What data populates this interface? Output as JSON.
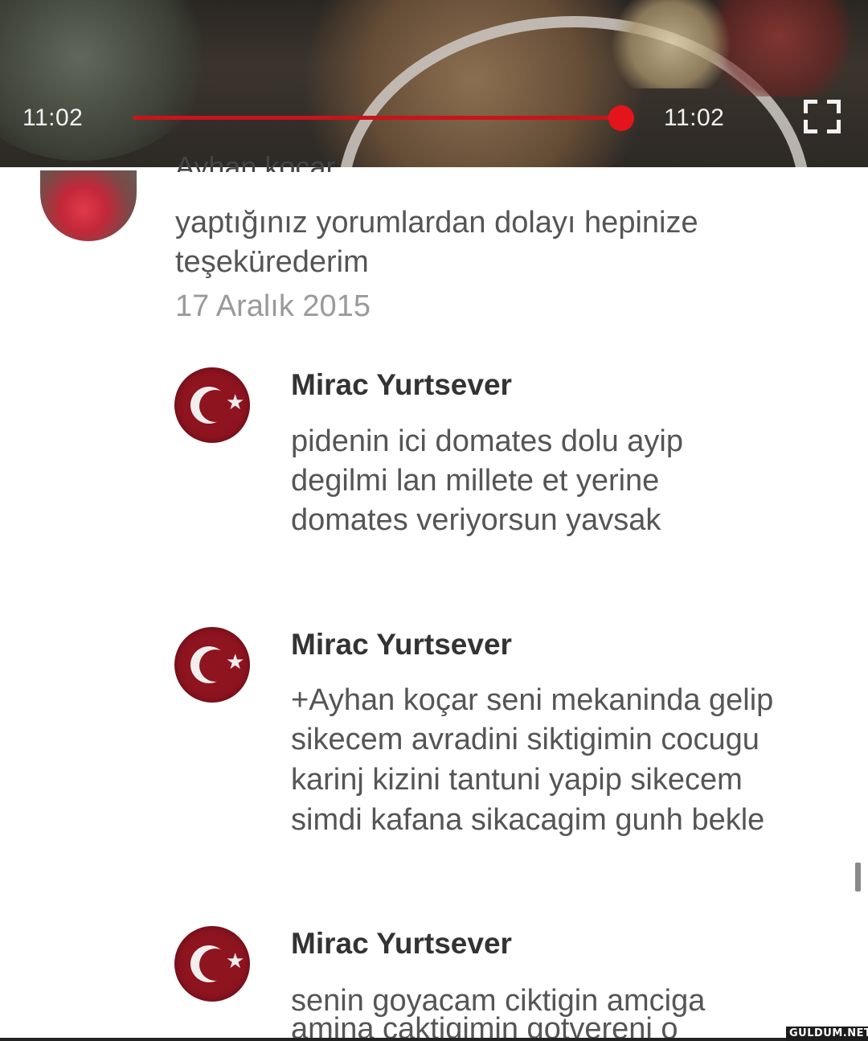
{
  "player": {
    "current_time": "11:02",
    "duration": "11:02",
    "progress_fraction": 1.0,
    "accent_color": "#e4141c",
    "fullscreen_icon": "fullscreen-icon"
  },
  "comments": [
    {
      "author": "Ayhan koçar",
      "text_lines": [
        "yaptığınız yorumlardan dolayı hepinize",
        "teşekürederim"
      ],
      "date": "17 Aralık 2015"
    },
    {
      "author": "Mirac Yurtsever",
      "text_lines": [
        "pidenin ici domates dolu ayip",
        "degilmi lan millete et yerine",
        "domates veriyorsun yavsak"
      ]
    },
    {
      "author": "Mirac Yurtsever",
      "text_lines": [
        "+Ayhan koçar seni mekaninda gelip",
        "sikecem avradini siktigimin cocugu",
        "karinj kizini tantuni yapip sikecem",
        "simdi kafana sikacagim gunh bekle"
      ]
    },
    {
      "author": "Mirac Yurtsever",
      "text_lines": [
        "senin goyacam ciktigin amciga",
        "amina caktigimin gotvereni o"
      ]
    }
  ],
  "watermark": "GULDUM.NET",
  "colors": {
    "flag_red": "#8e1420",
    "date_gray": "#9a9a9a"
  }
}
